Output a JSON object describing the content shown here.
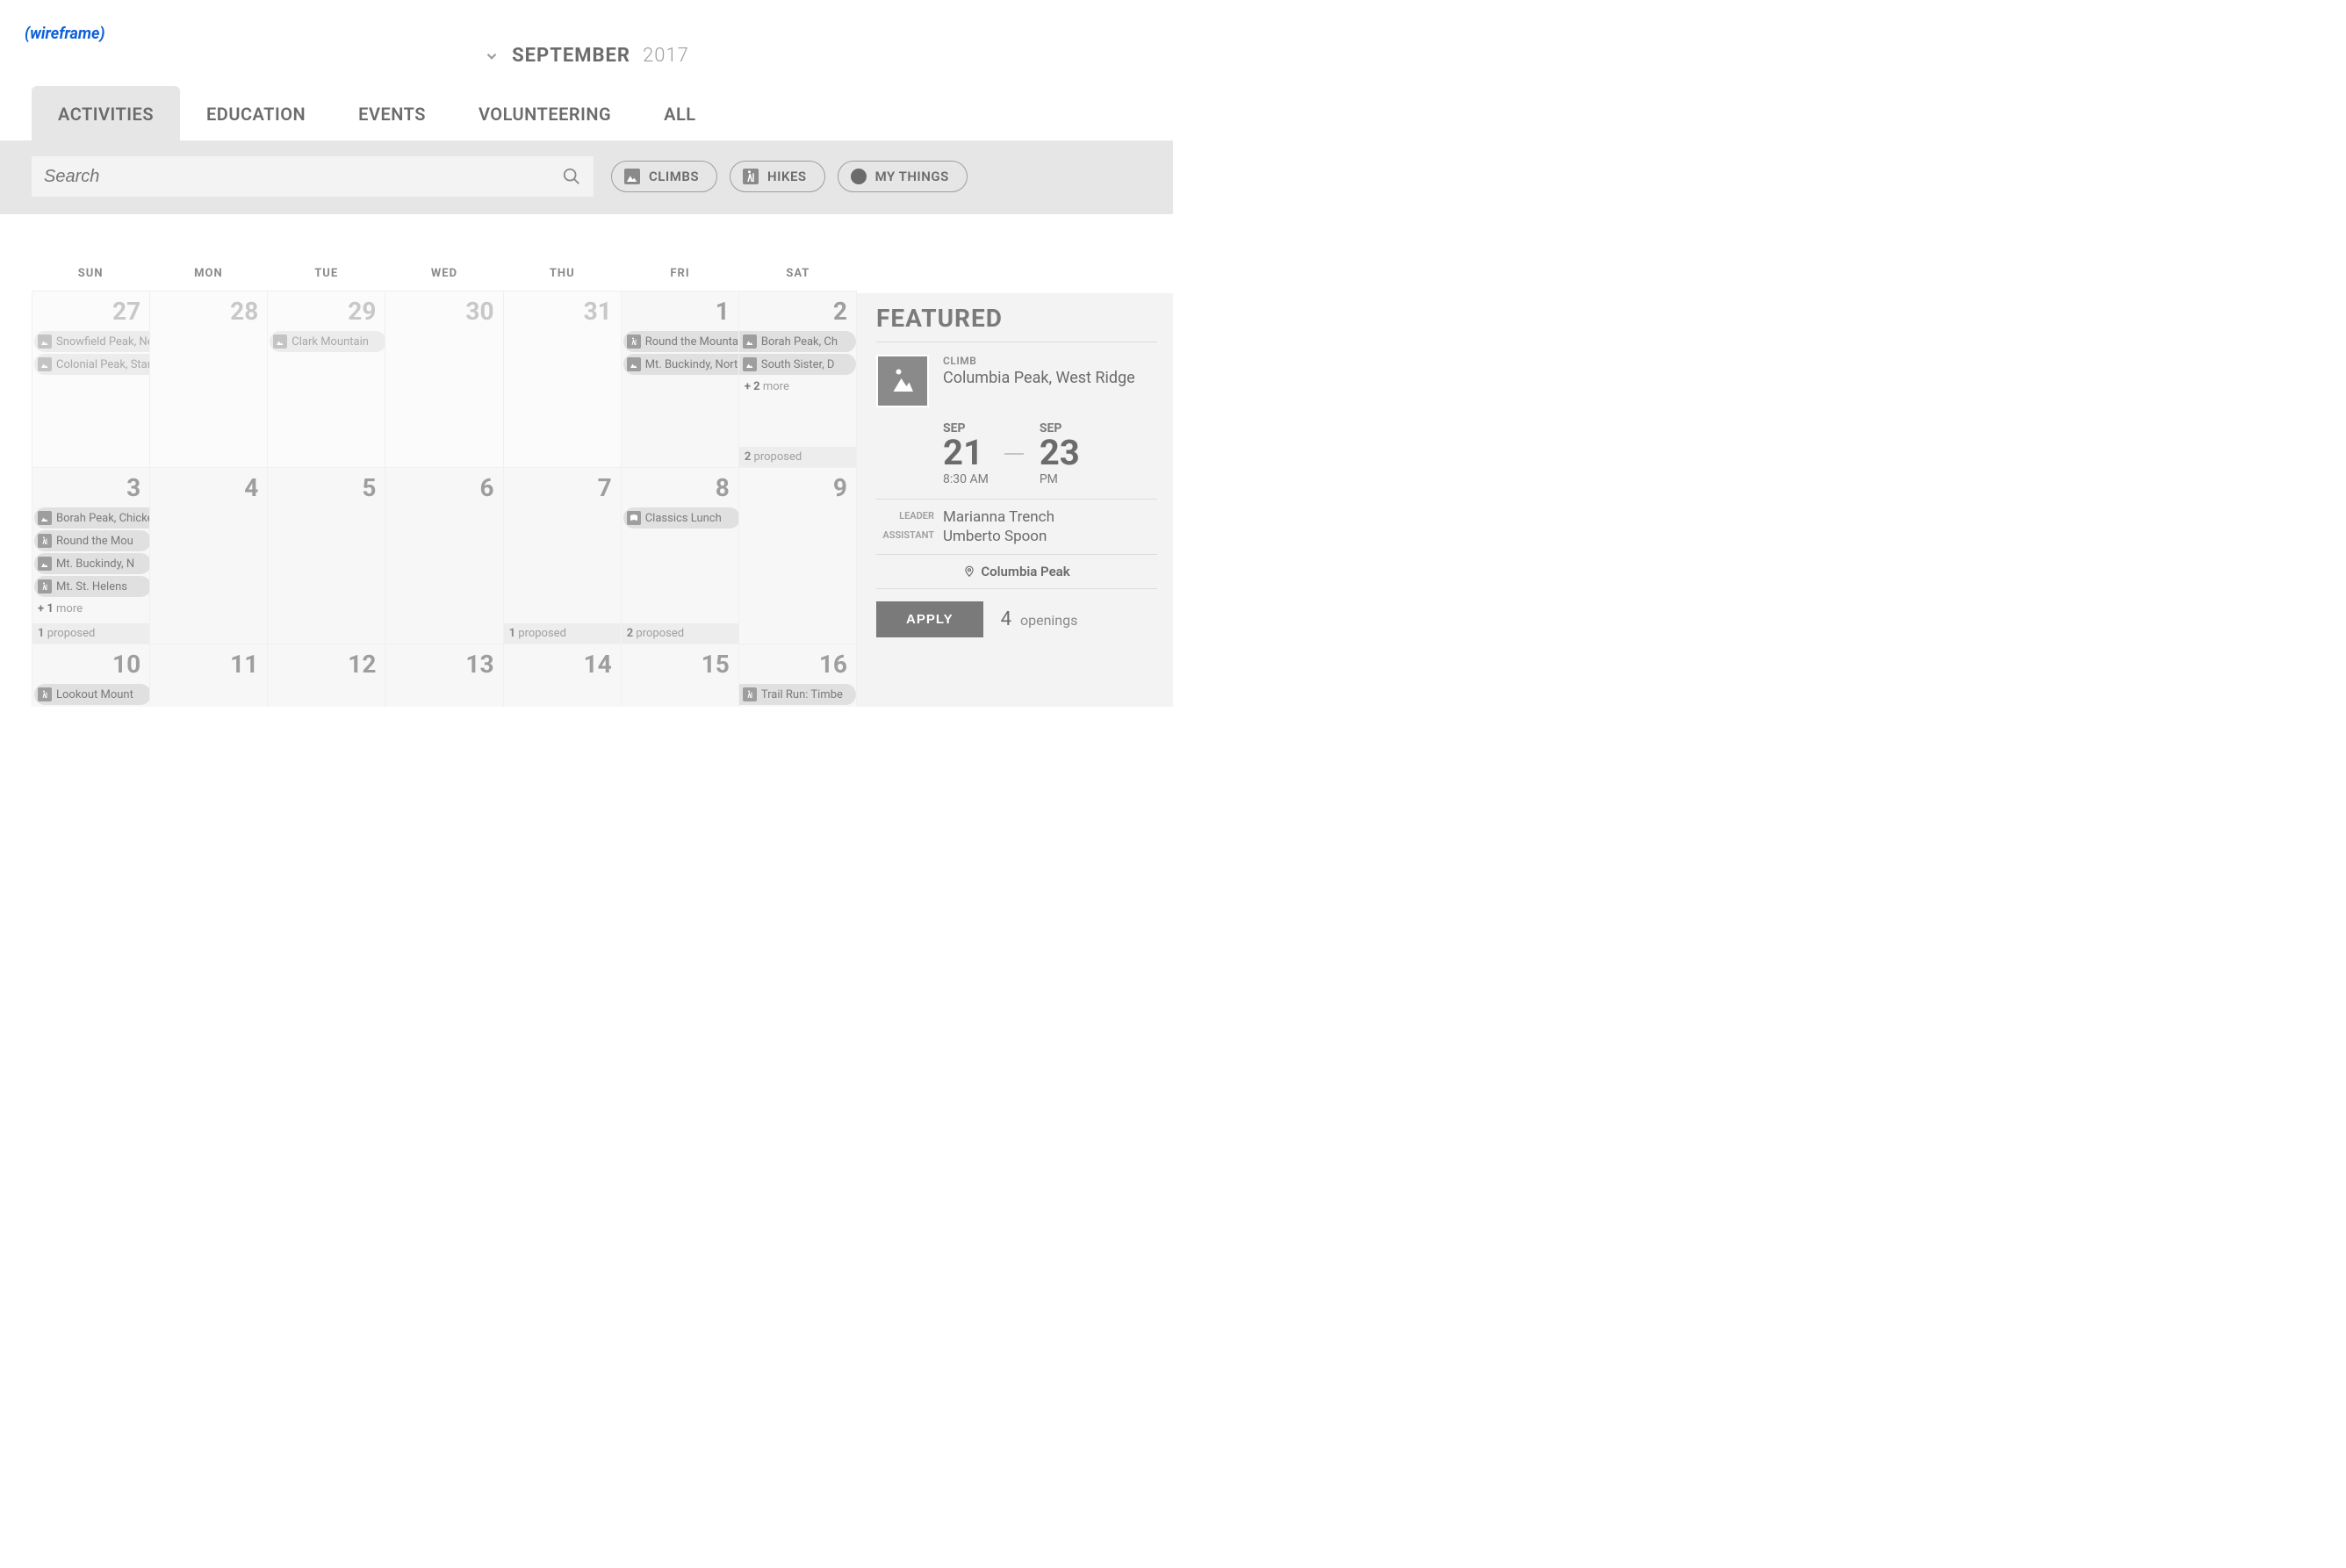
{
  "wireframe_label": "(wireframe)",
  "header": {
    "month": "SEPTEMBER",
    "year": "2017"
  },
  "tabs": [
    {
      "label": "ACTIVITIES",
      "active": true
    },
    {
      "label": "EDUCATION"
    },
    {
      "label": "EVENTS"
    },
    {
      "label": "VOLUNTEERING"
    },
    {
      "label": "ALL"
    }
  ],
  "search": {
    "placeholder": "Search"
  },
  "chips": [
    {
      "label": "CLIMBS",
      "icon": "climb"
    },
    {
      "label": "HIKES",
      "icon": "hike"
    },
    {
      "label": "MY THINGS",
      "icon": "dot"
    }
  ],
  "dow": [
    "SUN",
    "MON",
    "TUE",
    "WED",
    "THU",
    "FRI",
    "SAT"
  ],
  "weeks": [
    {
      "days": [
        {
          "num": "27",
          "out": true,
          "events": [
            {
              "icon": "climb",
              "label": "Snowfield Peak, Neve Glacier",
              "span": 7,
              "out": true
            },
            {
              "icon": "climb",
              "label": "Colonial Peak, Standard West Ridge",
              "span": 7,
              "out": true
            }
          ]
        },
        {
          "num": "28",
          "out": true
        },
        {
          "num": "29",
          "out": true,
          "events": [
            {
              "icon": "climb",
              "label": "Clark Mountain",
              "span": 1,
              "out": true
            }
          ]
        },
        {
          "num": "30",
          "out": true
        },
        {
          "num": "31",
          "out": true
        },
        {
          "num": "1",
          "events": [
            {
              "icon": "hike",
              "label": "Round the Mountain",
              "span": 2,
              "slot": 0
            },
            {
              "icon": "climb",
              "label": "Mt. Buckindy, North Side",
              "span": 2,
              "slot": 2
            }
          ]
        },
        {
          "num": "2",
          "events": [
            {
              "icon": "climb",
              "label": "Borah Peak, Ch",
              "span": 1,
              "slot": 1,
              "rightstart": true
            },
            {
              "icon": "climb",
              "label": "South Sister, D",
              "span": 1,
              "slot": 3,
              "rightstart": true
            }
          ],
          "more": "+ 2",
          "more_text": "more",
          "proposed": "2",
          "proposed_text": "proposed"
        }
      ]
    },
    {
      "days": [
        {
          "num": "3",
          "events": [
            {
              "icon": "climb",
              "label": "Borah Peak, Chicken Out Ridge",
              "span": 2
            },
            {
              "icon": "hike",
              "label": "Round the Mou",
              "span": 1
            },
            {
              "icon": "climb",
              "label": "Mt. Buckindy, N",
              "span": 1
            },
            {
              "icon": "hike",
              "label": "Mt. St. Helens",
              "span": 1
            }
          ],
          "more": "+ 1",
          "more_text": "more",
          "proposed": "1",
          "proposed_text": "proposed"
        },
        {
          "num": "4"
        },
        {
          "num": "5"
        },
        {
          "num": "6"
        },
        {
          "num": "7",
          "proposed": "1",
          "proposed_text": "proposed"
        },
        {
          "num": "8",
          "events": [
            {
              "icon": "book",
              "label": "Classics Lunch",
              "span": 1
            }
          ],
          "proposed": "2",
          "proposed_text": "proposed"
        },
        {
          "num": "9"
        }
      ]
    },
    {
      "days": [
        {
          "num": "10",
          "events": [
            {
              "icon": "hike",
              "label": "Lookout Mount",
              "span": 1
            }
          ]
        },
        {
          "num": "11"
        },
        {
          "num": "12"
        },
        {
          "num": "13"
        },
        {
          "num": "14"
        },
        {
          "num": "15"
        },
        {
          "num": "16",
          "events": [
            {
              "icon": "hike",
              "label": "Trail Run: Timbe",
              "span": 1,
              "rightstart": true
            }
          ]
        }
      ],
      "short": true
    }
  ],
  "featured": {
    "heading": "FEATURED",
    "tag": "CLIMB",
    "title": "Columbia Peak, West Ridge",
    "start": {
      "month": "SEP",
      "day": "21",
      "time": "8:30 AM"
    },
    "end": {
      "month": "SEP",
      "day": "23",
      "time": "PM"
    },
    "leader_label": "LEADER",
    "leader": "Marianna Trench",
    "assistant_label": "ASSISTANT",
    "assistant": "Umberto Spoon",
    "location": "Columbia Peak",
    "apply_label": "APPLY",
    "openings_n": "4",
    "openings_label": "openings"
  }
}
